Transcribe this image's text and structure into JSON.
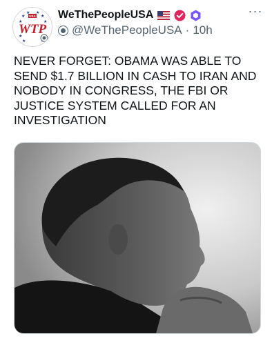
{
  "tweet": {
    "display_name": "WeThePeopleUSA",
    "handle": "@WeThePeopleUSA",
    "separator": "·",
    "time": "10h",
    "more_label": "···",
    "avatar": {
      "logo_text": "WTP",
      "logo_small": "USA",
      "icon": "wtp-logo-icon"
    },
    "badges": [
      {
        "icon": "us-flag-icon"
      },
      {
        "icon": "verified-badge-icon",
        "color": "#e0245e"
      },
      {
        "icon": "affiliate-badge-icon",
        "color": "#7856ff"
      }
    ],
    "text_lines": [
      "NEVER FORGET: OBAMA WAS ABLE TO",
      "SEND $1.7 BILLION IN CASH TO IRAN AND",
      "NOBODY IN CONGRESS, THE FBI OR",
      "JUSTICE SYSTEM CALLED FOR AN",
      "INVESTIGATION"
    ],
    "media": {
      "kind": "black-and-white portrait photo"
    }
  },
  "colors": {
    "text": "#0f1419",
    "secondary": "#536471",
    "verified": "#e0245e",
    "affiliate": "#7856ff",
    "logo_red": "#c0212b",
    "logo_blue": "#1c3c8c"
  }
}
